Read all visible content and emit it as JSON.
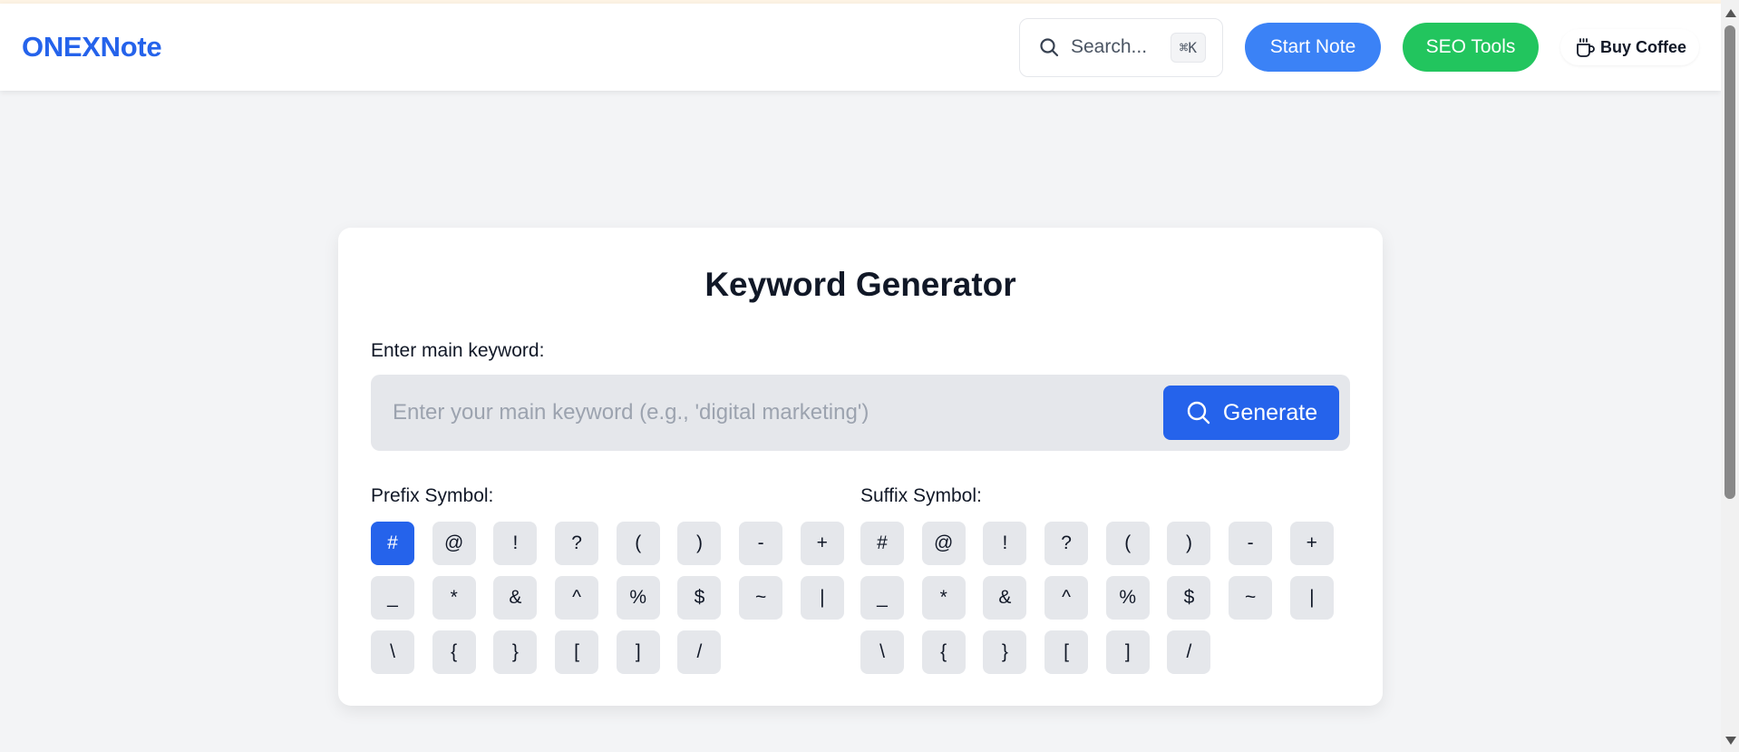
{
  "header": {
    "brand": "ONEXNote",
    "search": {
      "label": "Search...",
      "shortcut": "⌘K"
    },
    "start_note_label": "Start Note",
    "seo_tools_label": "SEO Tools",
    "buy_coffee_label": "Buy Coffee"
  },
  "card": {
    "title": "Keyword Generator",
    "input_label": "Enter main keyword:",
    "input_value": "",
    "input_placeholder": "Enter your main keyword (e.g., 'digital marketing')",
    "generate_label": "Generate"
  },
  "prefix": {
    "label": "Prefix Symbol:",
    "selected": "#",
    "symbols": [
      "#",
      "@",
      "!",
      "?",
      "(",
      ")",
      "-",
      "+",
      "_",
      "*",
      "&",
      "^",
      "%",
      "$",
      "~",
      "|",
      "\\",
      "{",
      "}",
      "[",
      "]",
      "/"
    ]
  },
  "suffix": {
    "label": "Suffix Symbol:",
    "selected": "",
    "symbols": [
      "#",
      "@",
      "!",
      "?",
      "(",
      ")",
      "-",
      "+",
      "_",
      "*",
      "&",
      "^",
      "%",
      "$",
      "~",
      "|",
      "\\",
      "{",
      "}",
      "[",
      "]",
      "/"
    ]
  },
  "colors": {
    "brand": "#2563eb",
    "start_note": "#3b82f6",
    "seo_tools": "#22c55e",
    "background": "#f3f4f6"
  },
  "icons": {
    "search": "search-icon",
    "coffee": "coffee-cup-icon",
    "generate": "search-icon"
  }
}
